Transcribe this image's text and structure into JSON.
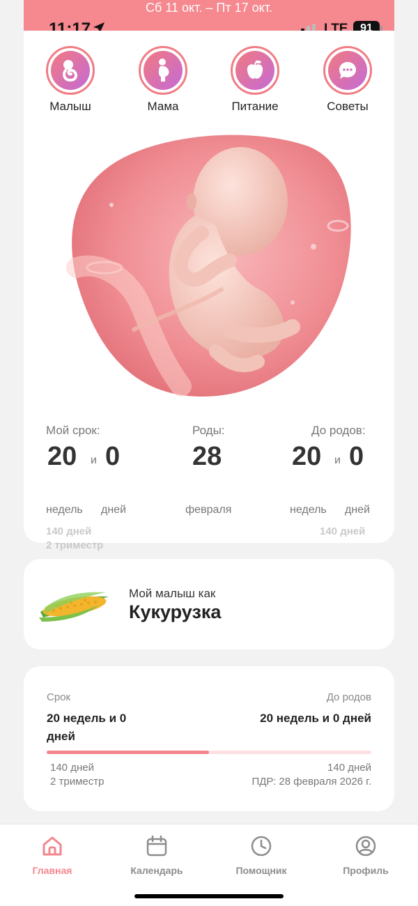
{
  "header": {
    "week_range": "Сб 11 окт. – Пт 17 окт."
  },
  "status_bar": {
    "time": "11:17",
    "network": "LTE",
    "battery": "91"
  },
  "categories": [
    {
      "label": "Малыш",
      "icon": "baby-icon"
    },
    {
      "label": "Мама",
      "icon": "pregnant-woman-icon"
    },
    {
      "label": "Питание",
      "icon": "apple-icon"
    },
    {
      "label": "Советы",
      "icon": "chat-bubble-icon"
    }
  ],
  "stats": {
    "my_term": {
      "label": "Мой срок:",
      "weeks": "20",
      "and": "и",
      "days": "0",
      "weeks_unit": "недель",
      "days_unit": "дней",
      "total_days": "140 дней",
      "trimester": "2 триместр"
    },
    "birth": {
      "label": "Роды:",
      "day": "28",
      "month": "февраля"
    },
    "until_birth": {
      "label": "До родов:",
      "weeks": "20",
      "and": "и",
      "days": "0",
      "weeks_unit": "недель",
      "days_unit": "дней",
      "total_days": "140 дней"
    }
  },
  "baby_size": {
    "subtitle": "Мой малыш как",
    "title": "Кукурузка",
    "icon": "corn-icon"
  },
  "progress": {
    "left_label": "Срок",
    "left_value_line1": "20 недель и 0",
    "left_value_line2": "дней",
    "right_label": "До родов",
    "right_value": "20 недель и 0 дней",
    "fraction": 0.5,
    "left_note1": "140 дней",
    "left_note2": "2 триместр",
    "right_note1": "140 дней",
    "right_note2": "ПДР: 28 февраля 2026 г."
  },
  "tabs": [
    {
      "label": "Главная",
      "icon": "home-icon",
      "active": true
    },
    {
      "label": "Календарь",
      "icon": "calendar-icon",
      "active": false
    },
    {
      "label": "Помощник",
      "icon": "clock-icon",
      "active": false
    },
    {
      "label": "Профиль",
      "icon": "profile-icon",
      "active": false
    }
  ],
  "colors": {
    "accent": "#f3868d",
    "header": "#f6888f",
    "gradient_end": "#c46ad6"
  }
}
